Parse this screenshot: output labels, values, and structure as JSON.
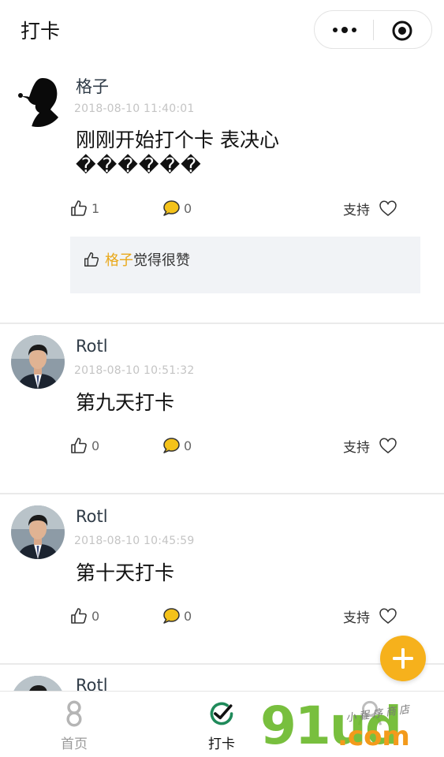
{
  "header": {
    "title": "打卡"
  },
  "capsule": {
    "more_icon": "more-dots-icon",
    "close_icon": "target-circle-icon"
  },
  "posts": [
    {
      "username": "格子",
      "time": "2018-08-10 11:40:01",
      "content_line1": "刚刚开始打个卡 表决心",
      "content_line2": "������",
      "like_count": "1",
      "comment_count": "0",
      "support_label": "支持",
      "liked_by": "格子",
      "liked_suffix": "觉得很赞"
    },
    {
      "username": "Rotl",
      "time": "2018-08-10 10:51:32",
      "content_line1": "第九天打卡",
      "like_count": "0",
      "comment_count": "0",
      "support_label": "支持"
    },
    {
      "username": "Rotl",
      "time": "2018-08-10 10:45:59",
      "content_line1": "第十天打卡",
      "like_count": "0",
      "comment_count": "0",
      "support_label": "支持"
    },
    {
      "username": "Rotl"
    }
  ],
  "tabbar": {
    "tabs": [
      {
        "label": "首页",
        "icon": "home-8-icon"
      },
      {
        "label": "打卡",
        "icon": "checkin-icon"
      },
      {
        "label": "",
        "icon": "profile-icon"
      }
    ]
  },
  "watermark": {
    "big": "91ud",
    "com": ".com",
    "small": "小程序商店"
  },
  "colors": {
    "accent": "#f6b11c",
    "liker_name": "#e9a81a",
    "timestamp": "#c4c4c4"
  }
}
